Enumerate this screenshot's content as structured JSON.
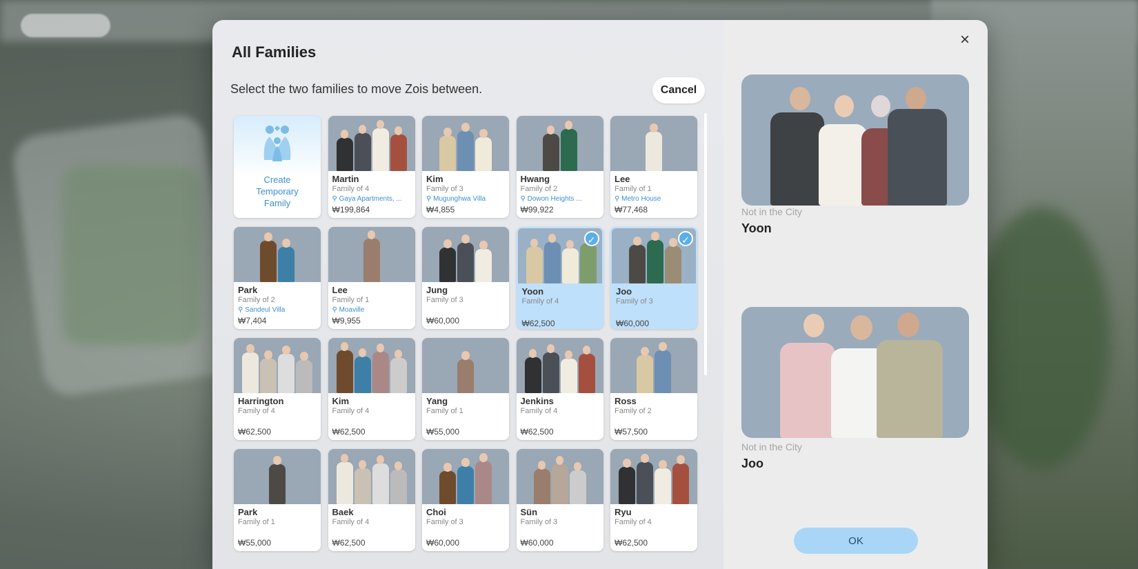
{
  "dialog": {
    "title": "All Families",
    "subtitle": "Select the two families to move Zois between.",
    "cancel_label": "Cancel",
    "ok_label": "OK",
    "close_icon": "×"
  },
  "create_card": {
    "label_lines": [
      "Create",
      "Temporary",
      "Family"
    ]
  },
  "currency_symbol": "₩",
  "families": [
    {
      "name": "Martin",
      "size": "Family of 4",
      "location": "Gaya Apartments, ...",
      "money": "199,864",
      "selected": false
    },
    {
      "name": "Kim",
      "size": "Family of 3",
      "location": "Mugunghwa Villa",
      "money": "4,855",
      "selected": false
    },
    {
      "name": "Hwang",
      "size": "Family of 2",
      "location": "Dowon Heights ...",
      "money": "99,922",
      "selected": false
    },
    {
      "name": "Lee",
      "size": "Family of 1",
      "location": "Metro House",
      "money": "77,468",
      "selected": false
    },
    {
      "name": "Park",
      "size": "Family of 2",
      "location": "Sandeul Villa",
      "money": "7,404",
      "selected": false
    },
    {
      "name": "Lee",
      "size": "Family of 1",
      "location": "Moaville",
      "money": "9,955",
      "selected": false
    },
    {
      "name": "Jung",
      "size": "Family of 3",
      "location": "",
      "money": "60,000",
      "selected": false
    },
    {
      "name": "Yoon",
      "size": "Family of 4",
      "location": "",
      "money": "62,500",
      "selected": true
    },
    {
      "name": "Joo",
      "size": "Family of 3",
      "location": "",
      "money": "60,000",
      "selected": true
    },
    {
      "name": "Harrington",
      "size": "Family of 4",
      "location": "",
      "money": "62,500",
      "selected": false
    },
    {
      "name": "Kim",
      "size": "Family of 4",
      "location": "",
      "money": "62,500",
      "selected": false
    },
    {
      "name": "Yang",
      "size": "Family of 1",
      "location": "",
      "money": "55,000",
      "selected": false
    },
    {
      "name": "Jenkins",
      "size": "Family of 4",
      "location": "",
      "money": "62,500",
      "selected": false
    },
    {
      "name": "Ross",
      "size": "Family of 2",
      "location": "",
      "money": "57,500",
      "selected": false
    },
    {
      "name": "Park",
      "size": "Family of 1",
      "location": "",
      "money": "55,000",
      "selected": false
    },
    {
      "name": "Baek",
      "size": "Family of 4",
      "location": "",
      "money": "62,500",
      "selected": false
    },
    {
      "name": "Choi",
      "size": "Family of 3",
      "location": "",
      "money": "60,000",
      "selected": false
    },
    {
      "name": "Sün",
      "size": "Family of 3",
      "location": "",
      "money": "60,000",
      "selected": false
    },
    {
      "name": "Ryu",
      "size": "Family of 4",
      "location": "",
      "money": "62,500",
      "selected": false
    }
  ],
  "selected_panel": [
    {
      "status": "Not in the City",
      "name": "Yoon",
      "members": 4
    },
    {
      "status": "Not in the City",
      "name": "Joo",
      "members": 3
    }
  ],
  "icons": {
    "pin": "location-pin-icon",
    "check": "checkmark-icon",
    "close": "close-icon",
    "create": "family-group-icon"
  },
  "colors": {
    "accent": "#5aaeea",
    "selected_card": "#bfe0fa",
    "link": "#3c8fd0",
    "ok_button": "#a9d6f7"
  }
}
